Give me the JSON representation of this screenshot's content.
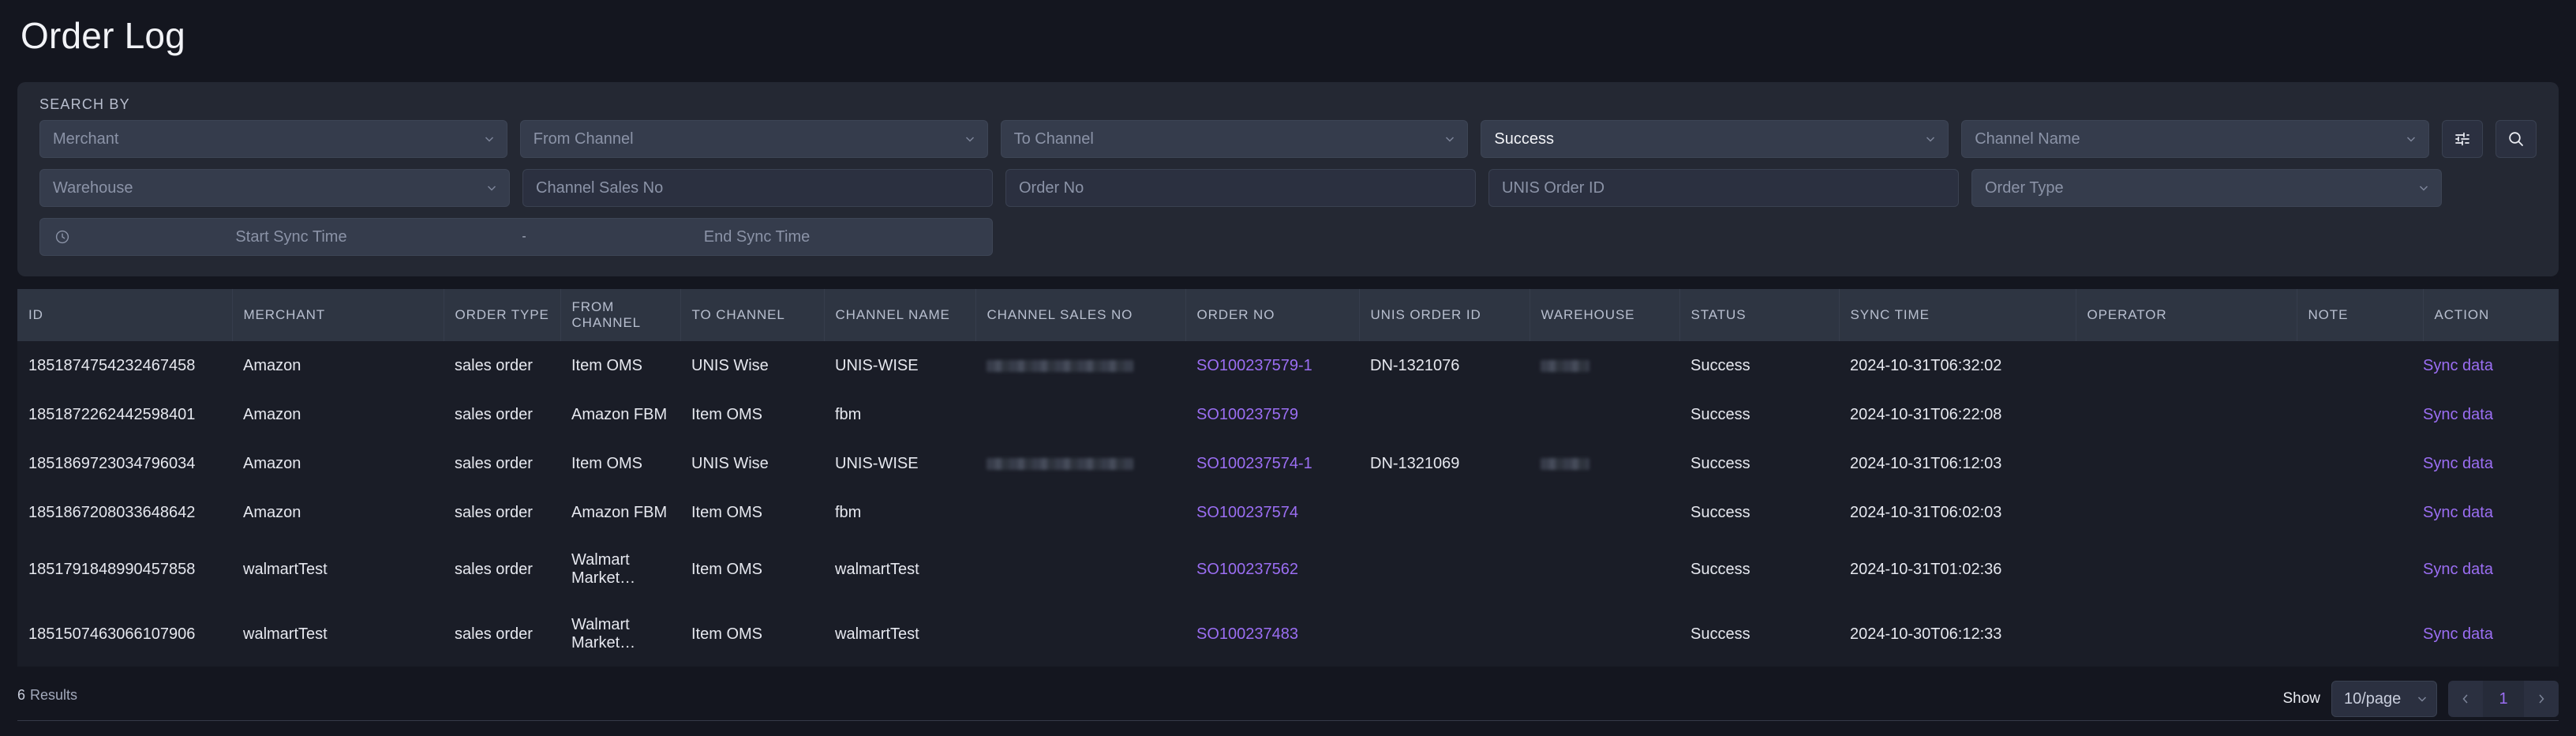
{
  "page": {
    "title": "Order Log"
  },
  "search": {
    "section_label": "SEARCH BY",
    "row1": [
      {
        "name": "merchant",
        "text": "Merchant",
        "type": "select",
        "selected": false
      },
      {
        "name": "from-channel",
        "text": "From Channel",
        "type": "select",
        "selected": false
      },
      {
        "name": "to-channel",
        "text": "To Channel",
        "type": "select",
        "selected": false
      },
      {
        "name": "status",
        "text": "Success",
        "type": "select",
        "selected": true
      },
      {
        "name": "channel-name",
        "text": "Channel Name",
        "type": "select",
        "selected": false
      }
    ],
    "row2": [
      {
        "name": "warehouse",
        "text": "Warehouse",
        "type": "select",
        "selected": false
      },
      {
        "name": "channel-sales-no",
        "text": "Channel Sales No",
        "type": "input",
        "selected": false
      },
      {
        "name": "order-no",
        "text": "Order No",
        "type": "input",
        "selected": false
      },
      {
        "name": "unis-order-id",
        "text": "UNIS Order ID",
        "type": "input",
        "selected": false
      },
      {
        "name": "order-type",
        "text": "Order Type",
        "type": "select",
        "selected": false
      }
    ],
    "date_range": {
      "start_placeholder": "Start Sync Time",
      "separator": "-",
      "end_placeholder": "End Sync Time"
    },
    "buttons": {
      "advanced_filter_icon": "sliders-icon",
      "search_icon": "search-icon"
    }
  },
  "table": {
    "columns": [
      "ID",
      "MERCHANT",
      "ORDER TYPE",
      "FROM CHANNEL",
      "TO CHANNEL",
      "CHANNEL NAME",
      "CHANNEL SALES NO",
      "ORDER NO",
      "UNIS ORDER ID",
      "WAREHOUSE",
      "STATUS",
      "SYNC TIME",
      "OPERATOR",
      "NOTE",
      "ACTION"
    ],
    "rows": [
      {
        "id": "1851874754232467458",
        "merchant": "Amazon",
        "order_type": "sales order",
        "from_channel": "Item OMS",
        "to_channel": "UNIS Wise",
        "channel_name": "UNIS-WISE",
        "channel_sales_no": "",
        "channel_sales_no_redacted": true,
        "order_no": "SO100237579-1",
        "unis_order_id": "DN-1321076",
        "warehouse": "",
        "warehouse_redacted": true,
        "status": "Success",
        "sync_time": "2024-10-31T06:32:02",
        "operator": "",
        "note": "",
        "action": "Sync data"
      },
      {
        "id": "1851872262442598401",
        "merchant": "Amazon",
        "order_type": "sales order",
        "from_channel": "Amazon FBM",
        "to_channel": "Item OMS",
        "channel_name": "fbm",
        "channel_sales_no": "",
        "channel_sales_no_redacted": false,
        "order_no": "SO100237579",
        "unis_order_id": "",
        "warehouse": "",
        "warehouse_redacted": false,
        "status": "Success",
        "sync_time": "2024-10-31T06:22:08",
        "operator": "",
        "note": "",
        "action": "Sync data"
      },
      {
        "id": "1851869723034796034",
        "merchant": "Amazon",
        "order_type": "sales order",
        "from_channel": "Item OMS",
        "to_channel": "UNIS Wise",
        "channel_name": "UNIS-WISE",
        "channel_sales_no": "",
        "channel_sales_no_redacted": true,
        "order_no": "SO100237574-1",
        "unis_order_id": "DN-1321069",
        "warehouse": "",
        "warehouse_redacted": true,
        "status": "Success",
        "sync_time": "2024-10-31T06:12:03",
        "operator": "",
        "note": "",
        "action": "Sync data"
      },
      {
        "id": "1851867208033648642",
        "merchant": "Amazon",
        "order_type": "sales order",
        "from_channel": "Amazon FBM",
        "to_channel": "Item OMS",
        "channel_name": "fbm",
        "channel_sales_no": "",
        "channel_sales_no_redacted": false,
        "order_no": "SO100237574",
        "unis_order_id": "",
        "warehouse": "",
        "warehouse_redacted": false,
        "status": "Success",
        "sync_time": "2024-10-31T06:02:03",
        "operator": "",
        "note": "",
        "action": "Sync data"
      },
      {
        "id": "1851791848990457858",
        "merchant": "walmartTest",
        "order_type": "sales order",
        "from_channel": "Walmart Market…",
        "to_channel": "Item OMS",
        "channel_name": "walmartTest",
        "channel_sales_no": "",
        "channel_sales_no_redacted": false,
        "order_no": "SO100237562",
        "unis_order_id": "",
        "warehouse": "",
        "warehouse_redacted": false,
        "status": "Success",
        "sync_time": "2024-10-31T01:02:36",
        "operator": "",
        "note": "",
        "action": "Sync data"
      },
      {
        "id": "1851507463066107906",
        "merchant": "walmartTest",
        "order_type": "sales order",
        "from_channel": "Walmart Market…",
        "to_channel": "Item OMS",
        "channel_name": "walmartTest",
        "channel_sales_no": "",
        "channel_sales_no_redacted": false,
        "order_no": "SO100237483",
        "unis_order_id": "",
        "warehouse": "",
        "warehouse_redacted": false,
        "status": "Success",
        "sync_time": "2024-10-30T06:12:33",
        "operator": "",
        "note": "",
        "action": "Sync data"
      }
    ]
  },
  "footer": {
    "results_count": "6",
    "results_label": "Results",
    "show_label": "Show",
    "per_page": "10/page",
    "prev_icon": "chevron-left-icon",
    "next_icon": "chevron-right-icon",
    "current_page": "1"
  },
  "colors": {
    "background": "#14161f",
    "panel": "#242833",
    "field": "#353c4c",
    "input": "#2b3040",
    "table_header": "#2e3542",
    "table_row": "#1a1d27",
    "accent_link": "#9b6ef3",
    "text_primary": "#f2f3f7",
    "text_muted": "#8b93a7"
  }
}
